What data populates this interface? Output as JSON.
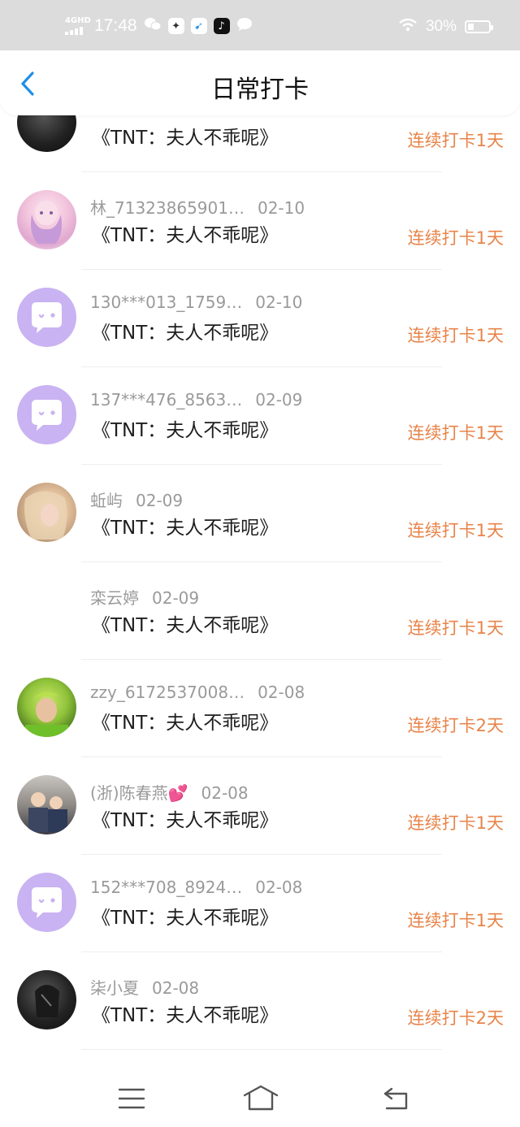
{
  "status_bar": {
    "network": "4GHD",
    "time": "17:48",
    "battery": "30%",
    "battery_level": 0.3,
    "icons": [
      "wechat-icon",
      "bird-app-icon",
      "feishu-icon",
      "tiktok-icon",
      "message-icon",
      "wifi-icon",
      "battery-icon"
    ]
  },
  "header": {
    "title": "日常打卡",
    "back_icon": "chevron-left-icon"
  },
  "list": [
    {
      "name": "",
      "date": "",
      "content": "《TNT：夫人不乖呢》",
      "streak": "连续打卡1天",
      "avatar": "dark-photo"
    },
    {
      "name": "林_71323865901…",
      "date": "02-10",
      "content": "《TNT：夫人不乖呢》",
      "streak": "连续打卡1天",
      "avatar": "anime-girl"
    },
    {
      "name": "130***013_1759…",
      "date": "02-10",
      "content": "《TNT：夫人不乖呢》",
      "streak": "连续打卡1天",
      "avatar": "default-purple"
    },
    {
      "name": "137***476_8563…",
      "date": "02-09",
      "content": "《TNT：夫人不乖呢》",
      "streak": "连续打卡1天",
      "avatar": "default-purple"
    },
    {
      "name": "蚯屿",
      "date": "02-09",
      "content": "《TNT：夫人不乖呢》",
      "streak": "连续打卡1天",
      "avatar": "blonde-photo"
    },
    {
      "name": "栾云婷",
      "date": "02-09",
      "content": "《TNT：夫人不乖呢》",
      "streak": "连续打卡1天",
      "avatar": "none"
    },
    {
      "name": "zzy_6172537008…",
      "date": "02-08",
      "content": "《TNT：夫人不乖呢》",
      "streak": "连续打卡2天",
      "avatar": "green-photo"
    },
    {
      "name": "(浙)陈春燕💕",
      "date": "02-08",
      "content": "《TNT：夫人不乖呢》",
      "streak": "连续打卡1天",
      "avatar": "family-photo"
    },
    {
      "name": "152***708_8924…",
      "date": "02-08",
      "content": "《TNT：夫人不乖呢》",
      "streak": "连续打卡1天",
      "avatar": "default-purple"
    },
    {
      "name": "柒小夏",
      "date": "02-08",
      "content": "《TNT：夫人不乖呢》",
      "streak": "连续打卡2天",
      "avatar": "dark-photo"
    }
  ],
  "nav": {
    "menu_icon": "menu-icon",
    "home_icon": "home-icon",
    "back_icon": "back-icon"
  },
  "colors": {
    "accent_blue": "#1f8fe8",
    "streak_orange": "#e8844a",
    "status_bar_bg": "#dcdcdc",
    "default_avatar_purple": "#c9b3f2"
  }
}
